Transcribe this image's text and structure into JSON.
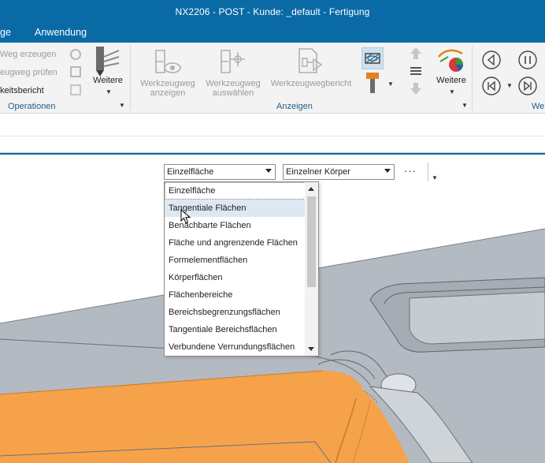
{
  "window": {
    "title": "NX2206 - POST - Kunde: _default - Fertigung"
  },
  "menubar": {
    "items": [
      "ge",
      "Anwendung"
    ]
  },
  "ribbon": {
    "operations_group": {
      "items": [
        "Weg erzeugen",
        "eugweg prüfen",
        "keitsbericht"
      ],
      "weitere_label": "Weitere",
      "label": "Operationen"
    },
    "display_group": {
      "show_toolpath": "Werkzeugweg anzeigen",
      "show_toolpath_l1": "Werkzeugweg",
      "show_toolpath_l2": "anzeigen",
      "select_toolpath_l1": "Werkzeugweg",
      "select_toolpath_l2": "auswählen",
      "toolpath_report": "Werkzeugwegbericht",
      "weitere_label": "Weitere",
      "label": "Anzeigen"
    },
    "next_group": {
      "label": "We"
    }
  },
  "filterbar": {
    "face_rule": "Einzelfläche",
    "body_rule": "Einzelner Körper",
    "more": "···"
  },
  "dropdown": {
    "options": [
      "Einzelfläche",
      "Tangentiale Flächen",
      "Benachbarte Flächen",
      "Fläche und angrenzende Flächen",
      "Formelementflächen",
      "Körperflächen",
      "Flächenbereiche",
      "Bereichsbegrenzungsflächen",
      "Tangentiale Bereichsflächen",
      "Verbundene Verrundungsflächen"
    ],
    "hovered_index": 1
  },
  "colors": {
    "accent": "#0a6aa6",
    "model_gray": "#b4bac1",
    "selected_face": "#f5a24b",
    "hover_row": "#dde8f3"
  }
}
